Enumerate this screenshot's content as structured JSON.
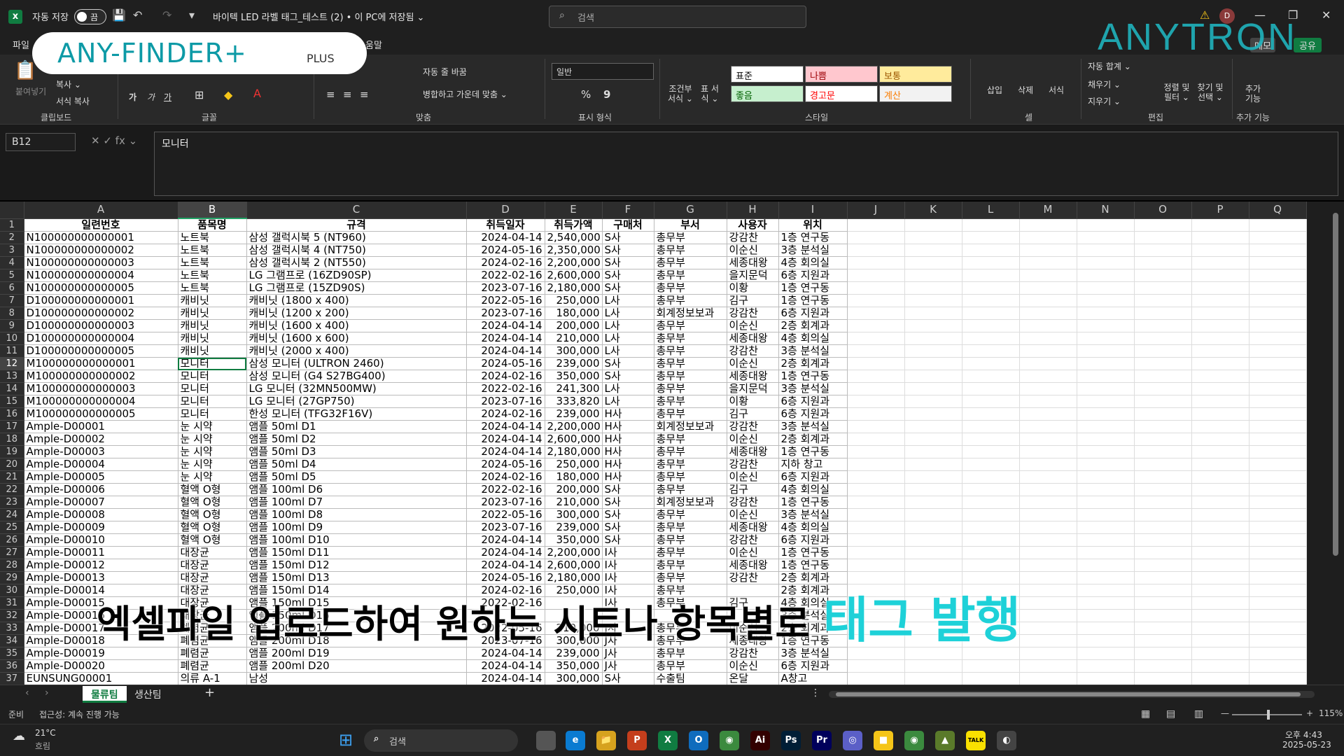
{
  "title": {
    "autosave": "자동 저장",
    "toggle": "끔",
    "filename": "바이텍 LED 라벨 태그_테스트 (2) • 이 PC에 저장됨 ⌄",
    "search": "검색",
    "avatar": "D"
  },
  "menu": {
    "file": "파일",
    "formula_partial": "움말"
  },
  "overlay": {
    "anyfinder": "ANY-FINDER+",
    "plus": "PLUS",
    "anytron": "ANYTRON",
    "share": "메모",
    "edit": "공유",
    "caption_main": "엑셀파일 업로드하여 원하는 시트나 항목별로 ",
    "caption_emph": "태그 발행"
  },
  "ribbon": {
    "paste": "붙여넣기",
    "copy": "복사 ⌄",
    "format_painter": "서식 복사",
    "clipboard": "클립보드",
    "font": "글꼴",
    "align": "맞춤",
    "wrap": "자동 줄 바꿈",
    "merge": "병합하고 가운데 맞춤 ⌄",
    "number_format": "일반",
    "number": "표시 형식",
    "cond_format": "조건부 서식 ⌄",
    "table_format": "표 서식 ⌄",
    "styles": [
      "표준",
      "나쁨",
      "보통",
      "좋음",
      "경고문",
      "계산"
    ],
    "style_group": "스타일",
    "insert": "삽입",
    "delete": "삭제",
    "format": "서식",
    "cells": "셀",
    "autosum": "자동 합계 ⌄",
    "fill": "채우기 ⌄",
    "clear": "지우기 ⌄",
    "sort": "정렬 및 필터 ⌄",
    "find": "찾기 및 선택 ⌄",
    "editing": "편집",
    "addins": "추가 기능",
    "addins_group": "추가 기능",
    "bold": "가",
    "italic": "가",
    "underline": "가",
    "percent": "%",
    "comma": "9"
  },
  "formula": {
    "cell": "B12",
    "fx": "✕ ✓ fx ⌄",
    "value": "모니터"
  },
  "columns": [
    "A",
    "B",
    "C",
    "D",
    "E",
    "F",
    "G",
    "H",
    "I",
    "J",
    "K",
    "L",
    "M",
    "N",
    "O",
    "P",
    "Q"
  ],
  "headers": [
    "일련번호",
    "품목명",
    "규격",
    "취득일자",
    "취득가액",
    "구매처",
    "부서",
    "사용자",
    "위치"
  ],
  "rows": [
    [
      "N100000000000001",
      "노트북",
      "삼성 갤럭시북 5 (NT960)",
      "2024-04-14",
      "2,540,000",
      "S사",
      "총무부",
      "강감찬",
      "1층 연구동"
    ],
    [
      "N100000000000002",
      "노트북",
      "삼성 갤럭시북 4 (NT750)",
      "2024-05-16",
      "2,350,000",
      "S사",
      "총무부",
      "이순신",
      "3층 분석실"
    ],
    [
      "N100000000000003",
      "노트북",
      "삼성 갤럭시북 2 (NT550)",
      "2024-02-16",
      "2,200,000",
      "S사",
      "총무부",
      "세종대왕",
      "4층 회의실"
    ],
    [
      "N100000000000004",
      "노트북",
      "LG 그램프로 (16ZD90SP)",
      "2022-02-16",
      "2,600,000",
      "S사",
      "총무부",
      "을지문덕",
      "6층 지원과"
    ],
    [
      "N100000000000005",
      "노트북",
      "LG 그램프로 (15ZD90S)",
      "2023-07-16",
      "2,180,000",
      "S사",
      "총무부",
      "이황",
      "1층 연구동"
    ],
    [
      "D100000000000001",
      "캐비닛",
      "캐비닛 (1800 x 400)",
      "2022-05-16",
      "250,000",
      "L사",
      "총무부",
      "김구",
      "1층 연구동"
    ],
    [
      "D100000000000002",
      "캐비닛",
      "캐비닛 (1200 x 200)",
      "2023-07-16",
      "180,000",
      "L사",
      "회계정보보과",
      "강감찬",
      "6층 지원과"
    ],
    [
      "D100000000000003",
      "캐비닛",
      "캐비닛 (1600 x 400)",
      "2024-04-14",
      "200,000",
      "L사",
      "총무부",
      "이순신",
      "2층 회계과"
    ],
    [
      "D100000000000004",
      "캐비닛",
      "캐비닛 (1600 x 600)",
      "2024-04-14",
      "210,000",
      "L사",
      "총무부",
      "세종대왕",
      "4층 회의실"
    ],
    [
      "D100000000000005",
      "캐비닛",
      "캐비닛 (2000 x 400)",
      "2024-04-14",
      "300,000",
      "L사",
      "총무부",
      "강감찬",
      "3층 분석실"
    ],
    [
      "M100000000000001",
      "모니터",
      "삼성 모니터 (ULTRON 2460)",
      "2024-05-16",
      "239,000",
      "S사",
      "총무부",
      "이순신",
      "2층 회계과"
    ],
    [
      "M100000000000002",
      "모니터",
      "삼성 모니터 (G4 S27BG400)",
      "2024-02-16",
      "350,000",
      "S사",
      "총무부",
      "세종대왕",
      "1층 연구동"
    ],
    [
      "M100000000000003",
      "모니터",
      "LG 모니터 (32MN500MW)",
      "2022-02-16",
      "241,300",
      "L사",
      "총무부",
      "을지문덕",
      "3층 분석실"
    ],
    [
      "M100000000000004",
      "모니터",
      "LG 모니터 (27GP750)",
      "2023-07-16",
      "333,820",
      "L사",
      "총무부",
      "이황",
      "6층 지원과"
    ],
    [
      "M100000000000005",
      "모니터",
      "한성 모니터 (TFG32F16V)",
      "2024-02-16",
      "239,000",
      "H사",
      "총무부",
      "김구",
      "6층 지원과"
    ],
    [
      "Ample-D00001",
      "눈 시약",
      "앰플 50ml D1",
      "2024-04-14",
      "2,200,000",
      "H사",
      "회계정보보과",
      "강감찬",
      "3층 분석실"
    ],
    [
      "Ample-D00002",
      "눈 시약",
      "앰플 50ml D2",
      "2024-04-14",
      "2,600,000",
      "H사",
      "총무부",
      "이순신",
      "2층 회계과"
    ],
    [
      "Ample-D00003",
      "눈 시약",
      "앰플 50ml D3",
      "2024-04-14",
      "2,180,000",
      "H사",
      "총무부",
      "세종대왕",
      "1층 연구동"
    ],
    [
      "Ample-D00004",
      "눈 시약",
      "앰플 50ml D4",
      "2024-05-16",
      "250,000",
      "H사",
      "총무부",
      "강감찬",
      "지하 창고"
    ],
    [
      "Ample-D00005",
      "눈 시약",
      "앰플 50ml D5",
      "2024-02-16",
      "180,000",
      "H사",
      "총무부",
      "이순신",
      "6층 지원과"
    ],
    [
      "Ample-D00006",
      "혈액 O형",
      "앰플 100ml D6",
      "2022-02-16",
      "200,000",
      "S사",
      "총무부",
      "김구",
      "4층 회의실"
    ],
    [
      "Ample-D00007",
      "혈액 O형",
      "앰플 100ml D7",
      "2023-07-16",
      "210,000",
      "S사",
      "회계정보보과",
      "강감찬",
      "1층 연구동"
    ],
    [
      "Ample-D00008",
      "혈액 O형",
      "앰플 100ml D8",
      "2022-05-16",
      "300,000",
      "S사",
      "총무부",
      "이순신",
      "3층 분석실"
    ],
    [
      "Ample-D00009",
      "혈액 O형",
      "앰플 100ml D9",
      "2023-07-16",
      "239,000",
      "S사",
      "총무부",
      "세종대왕",
      "4층 회의실"
    ],
    [
      "Ample-D00010",
      "혈액 O형",
      "앰플 100ml D10",
      "2024-04-14",
      "350,000",
      "S사",
      "총무부",
      "강감찬",
      "6층 지원과"
    ],
    [
      "Ample-D00011",
      "대장균",
      "앰플 150ml D11",
      "2024-04-14",
      "2,200,000",
      "I사",
      "총무부",
      "이순신",
      "1층 연구동"
    ],
    [
      "Ample-D00012",
      "대장균",
      "앰플 150ml D12",
      "2024-04-14",
      "2,600,000",
      "I사",
      "총무부",
      "세종대왕",
      "1층 연구동"
    ],
    [
      "Ample-D00013",
      "대장균",
      "앰플 150ml D13",
      "2024-05-16",
      "2,180,000",
      "I사",
      "총무부",
      "강감찬",
      "2층 회계과"
    ],
    [
      "Ample-D00014",
      "대장균",
      "앰플 150ml D14",
      "2024-02-16",
      "250,000",
      "I사",
      "총무부",
      "",
      "2층 회계과"
    ],
    [
      "Ample-D00015",
      "대장균",
      "앰플 150ml D15",
      "2022-02-16",
      "",
      "I사",
      "총무부",
      "김구",
      "4층 회의실"
    ],
    [
      "Ample-D00016",
      "대장균",
      "앰플 150ml D16",
      "",
      "",
      "",
      "",
      "",
      "3층 분석실"
    ],
    [
      "Ample-D00017",
      "폐렴균",
      "앰플 200ml D17",
      "2022-05-16",
      "210,000",
      "J사",
      "총무부",
      "이순신",
      "2층 회계과"
    ],
    [
      "Ample-D00018",
      "폐렴균",
      "앰플 200ml D18",
      "2023-07-16",
      "300,000",
      "J사",
      "총무부",
      "세종대왕",
      "1층 연구동"
    ],
    [
      "Ample-D00019",
      "폐렴균",
      "앰플 200ml D19",
      "2024-04-14",
      "239,000",
      "J사",
      "총무부",
      "강감찬",
      "3층 분석실"
    ],
    [
      "Ample-D00020",
      "폐렴균",
      "앰플 200ml D20",
      "2024-04-14",
      "350,000",
      "J사",
      "총무부",
      "이순신",
      "6층 지원과"
    ],
    [
      "EUNSUNG00001",
      "의류 A-1",
      "남성",
      "2024-04-14",
      "300,000",
      "S사",
      "수출팀",
      "온달",
      "A창고"
    ]
  ],
  "sheets": [
    "물류팀",
    "생산팀"
  ],
  "status": {
    "ready": "준비",
    "access": "접근성: 계속 진행 가능",
    "zoom": "115%"
  },
  "taskbar": {
    "temp": "21°C",
    "weather": "흐림",
    "search": "검색",
    "time": "오후 4:43",
    "date": "2025-05-23"
  },
  "taskbar_icons": [
    {
      "label": "",
      "color": "#555"
    },
    {
      "label": "e",
      "color": "#0a7bd1"
    },
    {
      "label": "📁",
      "color": "#d6a21e"
    },
    {
      "label": "P",
      "color": "#c43e1c"
    },
    {
      "label": "X",
      "color": "#107c41"
    },
    {
      "label": "O",
      "color": "#0f6cbd"
    },
    {
      "label": "◉",
      "color": "#3b8a3e"
    },
    {
      "label": "Ai",
      "color": "#330000"
    },
    {
      "label": "Ps",
      "color": "#001e36"
    },
    {
      "label": "Pr",
      "color": "#00005b"
    },
    {
      "label": "◎",
      "color": "#5b5fc7"
    },
    {
      "label": "■",
      "color": "#f5c518"
    },
    {
      "label": "◉",
      "color": "#3b8a3e"
    },
    {
      "label": "▲",
      "color": "#5a7a2a"
    },
    {
      "label": "TALK",
      "color": "#f9e000"
    },
    {
      "label": "◐",
      "color": "#444"
    }
  ]
}
